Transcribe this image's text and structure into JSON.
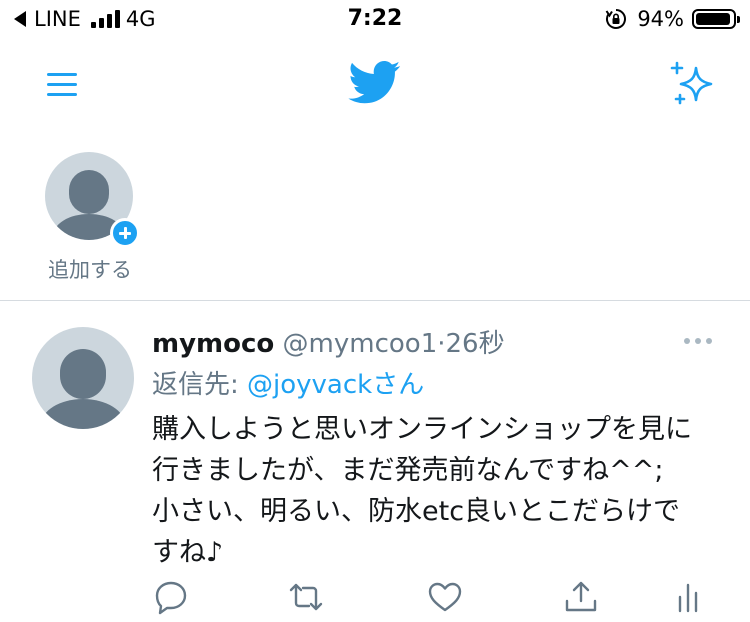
{
  "status_bar": {
    "carrier": "LINE",
    "network": "4G",
    "time": "7:22",
    "battery_percent": "94%",
    "battery_level": 0.94
  },
  "nav": {
    "menu_icon": "hamburger-menu-icon",
    "logo_icon": "twitter-bird-icon",
    "sparkle_icon": "sparkle-icon",
    "accent_color": "#1da1f2"
  },
  "fleets": {
    "add_label": "追加する"
  },
  "tweet": {
    "display_name": "mymoco",
    "handle": "@mymcoo1",
    "separator": "·",
    "time_ago": "26秒",
    "reply_prefix": "返信先: ",
    "reply_to": "@joyvackさん",
    "text_lines": [
      "購入しようと思いオンラインショップを見に",
      "行きましたが、まだ発売前なんですね^^;",
      "小さい、明るい、防水etc良いとこだらけで",
      "すね♪"
    ],
    "actions": [
      "reply-icon",
      "retweet-icon",
      "like-icon",
      "share-icon",
      "analytics-icon"
    ]
  }
}
